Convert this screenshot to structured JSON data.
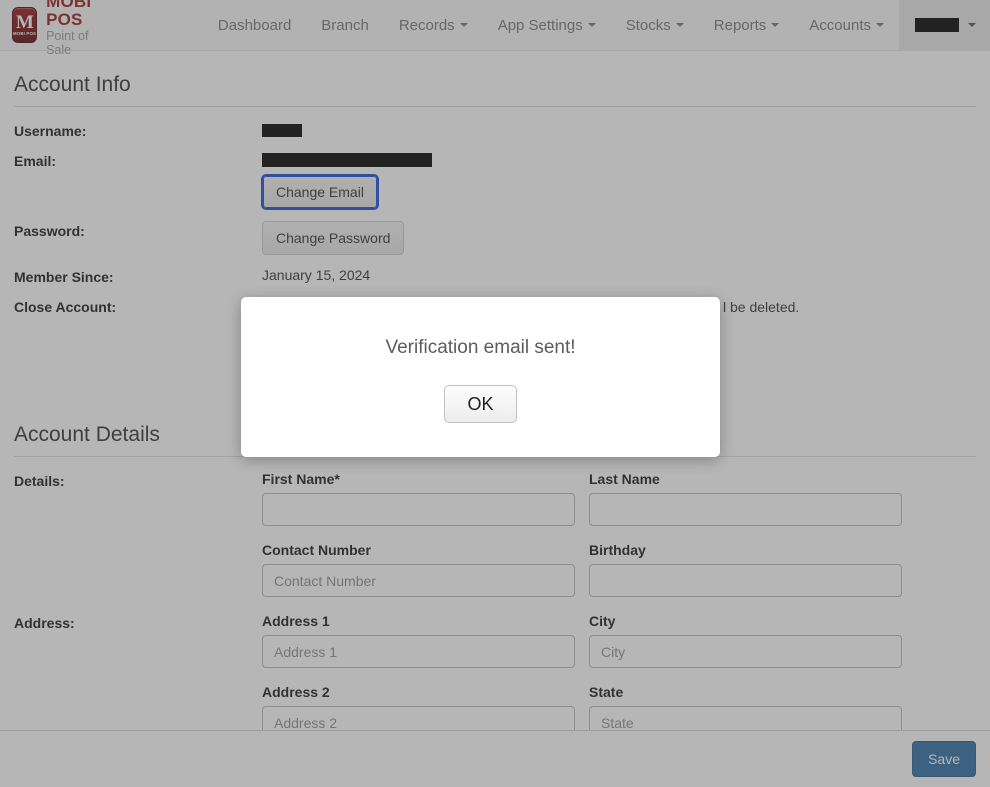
{
  "brand": {
    "logo_mark": "M",
    "logo_caption": "MOBI POS",
    "title": "MOBI POS",
    "subtitle": "Point of Sale"
  },
  "nav": {
    "items": [
      {
        "label": "Dashboard",
        "has_caret": false
      },
      {
        "label": "Branch",
        "has_caret": false
      },
      {
        "label": "Records",
        "has_caret": true
      },
      {
        "label": "App Settings",
        "has_caret": true
      },
      {
        "label": "Stocks",
        "has_caret": true
      },
      {
        "label": "Reports",
        "has_caret": true
      },
      {
        "label": "Accounts",
        "has_caret": true
      }
    ],
    "user_menu": {
      "label_redacted": true,
      "has_caret": true
    }
  },
  "account_info": {
    "heading": "Account Info",
    "rows": {
      "username_label": "Username:",
      "username_value_redacted": true,
      "email_label": "Email:",
      "email_value_redacted": true,
      "change_email_button": "Change Email",
      "password_label": "Password:",
      "change_password_button": "Change Password",
      "member_since_label": "Member Since:",
      "member_since_value": "January 15, 2024",
      "close_account_label": "Close Account:",
      "close_account_text_visible": "l be deleted."
    }
  },
  "account_details": {
    "heading": "Account Details",
    "details_label": "Details:",
    "address_label": "Address:",
    "fields": [
      {
        "label": "First Name*",
        "placeholder": "",
        "value": ""
      },
      {
        "label": "Last Name",
        "placeholder": "",
        "value": ""
      },
      {
        "label": "Contact Number",
        "placeholder": "Contact Number",
        "value": ""
      },
      {
        "label": "Birthday",
        "placeholder": "",
        "value": ""
      },
      {
        "label": "Address 1",
        "placeholder": "Address 1",
        "value": ""
      },
      {
        "label": "City",
        "placeholder": "City",
        "value": ""
      },
      {
        "label": "Address 2",
        "placeholder": "Address 2",
        "value": ""
      },
      {
        "label": "State",
        "placeholder": "State",
        "value": ""
      }
    ]
  },
  "footer": {
    "save_label": "Save"
  },
  "alert": {
    "message": "Verification email sent!",
    "ok_label": "OK"
  },
  "colors": {
    "brand_red": "#9b1b19",
    "save_blue": "#2e6da4",
    "focus_ring_blue": "#1a4fd6",
    "backdrop": "rgba(80,80,80,0.42)"
  }
}
